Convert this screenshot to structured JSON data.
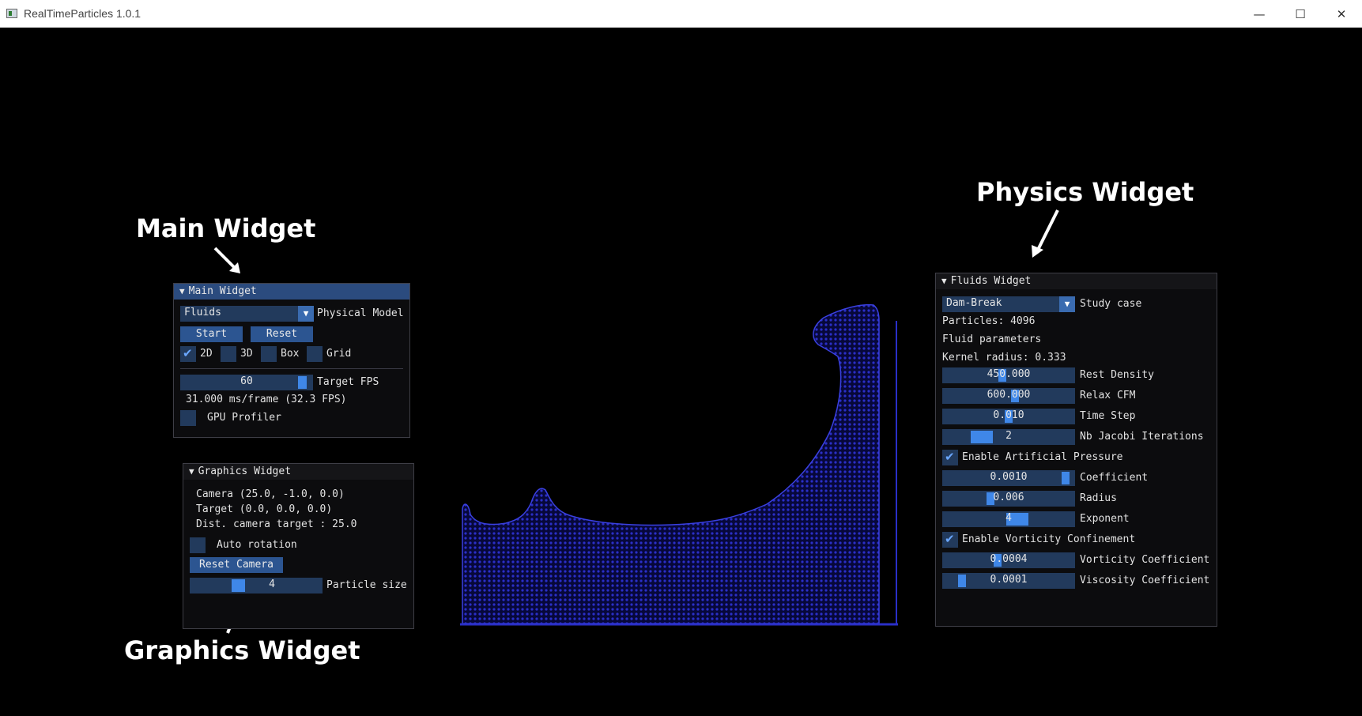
{
  "window": {
    "title": "RealTimeParticles 1.0.1",
    "minimize_glyph": "—",
    "maximize_glyph": "☐",
    "close_glyph": "✕"
  },
  "annotations": {
    "main": "Main Widget",
    "physics": "Physics Widget",
    "graphics": "Graphics Widget"
  },
  "main_widget": {
    "title": "Main Widget",
    "model_value": "Fluids",
    "model_label": "Physical Model",
    "start_label": "Start",
    "reset_label": "Reset",
    "checks": [
      {
        "label": "2D",
        "checked": true
      },
      {
        "label": "3D",
        "checked": false
      },
      {
        "label": "Box",
        "checked": false
      },
      {
        "label": "Grid",
        "checked": false
      }
    ],
    "fps_value": "60",
    "fps_fraction": 0.96,
    "fps_label": "Target FPS",
    "frame_stats": "31.000 ms/frame (32.3 FPS)",
    "gpu_profiler_label": "GPU Profiler"
  },
  "graphics_widget": {
    "title": "Graphics Widget",
    "camera": "Camera (25.0, -1.0, 0.0)",
    "target": "Target (0.0, 0.0, 0.0)",
    "dist": "Dist. camera target : 25.0",
    "auto_rotation_label": "Auto rotation",
    "reset_camera_label": "Reset Camera",
    "particle_size_value": "4",
    "particle_size_fraction": 0.35,
    "particle_size_label": "Particle size"
  },
  "fluids_widget": {
    "title": "Fluids Widget",
    "study_case_value": "Dam-Break",
    "study_case_label": "Study case",
    "particles": "Particles: 4096",
    "fluid_params": "Fluid parameters",
    "kernel_radius": "Kernel radius: 0.333",
    "sliders": [
      {
        "value": "450.000",
        "label": "Rest Density",
        "fraction": 0.45
      },
      {
        "value": "600.000",
        "label": "Relax CFM",
        "fraction": 0.55
      },
      {
        "value": "0.010",
        "label": "Time Step",
        "fraction": 0.5
      },
      {
        "value": "2",
        "label": "Nb Jacobi Iterations",
        "fraction": 0.25
      }
    ],
    "artificial_pressure_label": "Enable Artificial Pressure",
    "pressure_sliders": [
      {
        "value": "0.0010",
        "label": "Coefficient",
        "fraction": 0.97
      },
      {
        "value": "0.006",
        "label": "Radius",
        "fraction": 0.35
      },
      {
        "value": "4",
        "label": "Exponent",
        "fraction": 0.58
      }
    ],
    "vorticity_label": "Enable Vorticity Confinement",
    "vorticity_sliders": [
      {
        "value": "0.0004",
        "label": "Vorticity Coefficient",
        "fraction": 0.41
      },
      {
        "value": "0.0001",
        "label": "Viscosity Coefficient",
        "fraction": 0.12
      }
    ]
  },
  "colors": {
    "title_active": "#2b4b7e",
    "frame": "#223a5c",
    "button": "#2c5591",
    "grab": "#3f87e8",
    "fluid": "#2a2fc8"
  },
  "icons": {
    "collapse": "▼",
    "check": "✔"
  }
}
